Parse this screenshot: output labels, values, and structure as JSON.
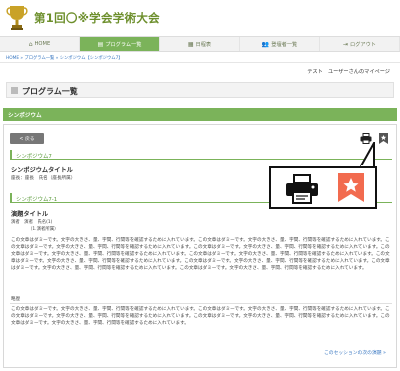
{
  "site": {
    "title": "第1回〇※学会学術大会"
  },
  "nav": {
    "items": [
      {
        "icon": "⌂",
        "label": "HOME"
      },
      {
        "icon": "▤",
        "label": "プログラム一覧"
      },
      {
        "icon": "▦",
        "label": "日程表"
      },
      {
        "icon": "👥",
        "label": "登壇者一覧"
      },
      {
        "icon": "⇥",
        "label": "ログアウト"
      }
    ]
  },
  "breadcrumb": "HOME » プログラム一覧 » シンポジウム【シンポジウム7】",
  "mypage": "テスト　ユーザーさんのマイページ",
  "page_heading": "プログラム一覧",
  "section_title": "シンポジウム",
  "back_label": "< 戻る",
  "symposium": {
    "bar_label": "シンポジウム7",
    "title": "シンポジウムタイトル",
    "organizers": "座長：座長　氏名（座長所属）"
  },
  "presentation": {
    "bar_label": "シンポジウム7-1",
    "title": "演題タイトル",
    "info": "演者　演者　氏名(1)",
    "affiliation": "（1.演者所属）",
    "body": "この文章はダミーです。文字の大きさ、量、字間、行間等を確認するために入れています。この文章はダミーです。文字の大きさ、量、字間、行間等を確認するために入れています。この文章はダミーです。文字の大きさ、量、字間、行間等を確認するために入れています。この文章はダミーです。文字の大きさ、量、字間、行間等を確認するために入れています。この文章はダミーです。文字の大きさ、量、字間、行間等を確認するために入れています。この文章はダミーです。文字の大きさ、量、字間、行間等を確認するために入れています。この文章はダミーです。文字の大きさ、量、字間、行間等を確認するために入れています。この文章はダミーです。文字の大きさ、量、字間、行間等を確認するために入れています。この文章はダミーです。文字の大きさ、量、字間、行間等を確認するために入れています。この文章はダミーです。文字の大きさ、量、字間、行間等を確認するために入れています。",
    "abbr_label": "略歴",
    "abbr_text": "この文章はダミーです。文字の大きさ、量、字間、行間等を確認するために入れています。この文章はダミーです。文字の大きさ、量、字間、行間等を確認するために入れています。この文章はダミーです。文字の大きさ、量、字間、行間等を確認するために入れています。この文章はダミーです。文字の大きさ、量、字間、行間等を確認するために入れています。この文章はダミーです。文字の大きさ、量、字間、行間等を確認するために入れています。"
  },
  "next_link": "このセッションの次の演題 »",
  "colors": {
    "accent": "#7bb35a",
    "title": "#6d8f2c",
    "link": "#3a78c2",
    "bookmark": "#f26b4f"
  }
}
